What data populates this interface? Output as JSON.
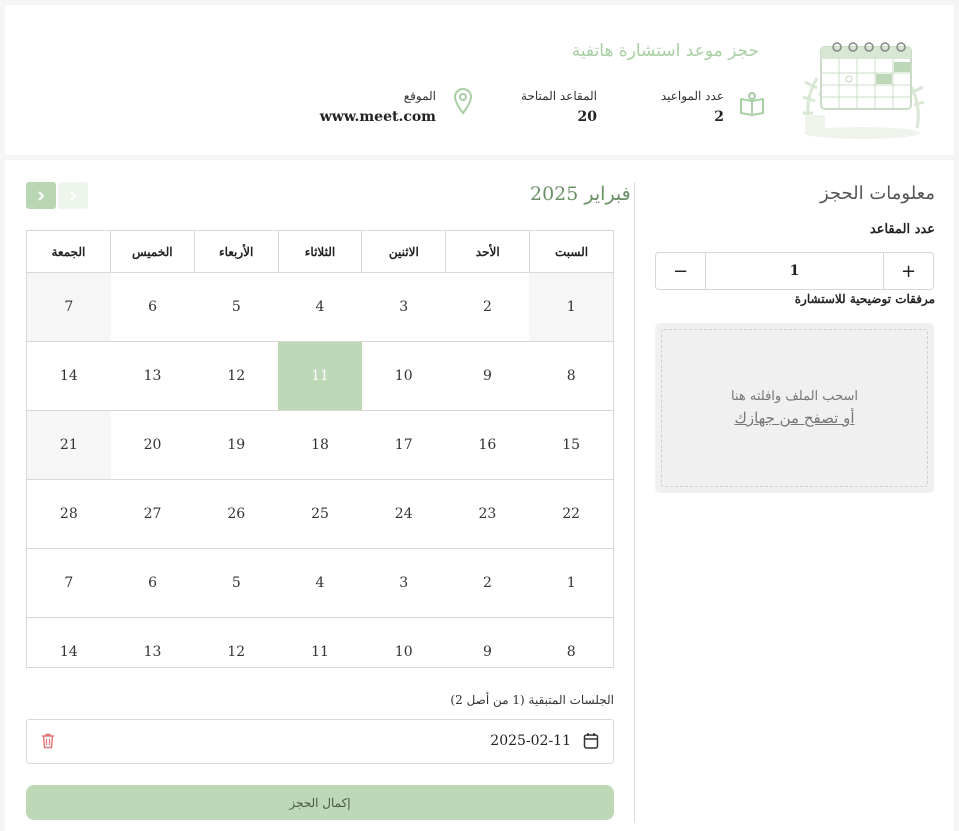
{
  "header": {
    "title": "حجز موعد استشارة هاتفية",
    "stats": [
      {
        "label": "عدد المواعيد",
        "value": "2",
        "icon": "book-icon"
      },
      {
        "label": "المقاعد المتاحة",
        "value": "20"
      },
      {
        "label": "الموقع",
        "value": "www.meet.com",
        "icon": "map-pin-icon"
      }
    ]
  },
  "booking": {
    "title": "معلومات الحجز",
    "seats_label": "عدد المقاعد",
    "seats_value": "1",
    "plus": "+",
    "minus": "−",
    "attachments_label": "مرفقات توضيحية للاستشارة",
    "dropzone_text": "اسحب الملف وافلته هنا",
    "dropzone_link": "أو تصفح من جهازك"
  },
  "calendar": {
    "month_title": "فبراير 2025",
    "weekdays": [
      "السبت",
      "الأحد",
      "الاثنين",
      "الثلاثاء",
      "الأربعاء",
      "الخميس",
      "الجمعة"
    ],
    "rows": [
      [
        "1",
        "2",
        "3",
        "4",
        "5",
        "6",
        "7"
      ],
      [
        "8",
        "9",
        "10",
        "11",
        "12",
        "13",
        "14"
      ],
      [
        "15",
        "16",
        "17",
        "18",
        "19",
        "20",
        "21"
      ],
      [
        "22",
        "23",
        "24",
        "25",
        "26",
        "27",
        "28"
      ],
      [
        "1",
        "2",
        "3",
        "4",
        "5",
        "6",
        "7"
      ],
      [
        "8",
        "9",
        "10",
        "11",
        "12",
        "13",
        "14"
      ]
    ],
    "selected_day": "11"
  },
  "sessions": {
    "label": "الجلسات المتبقية (1 من أصل 2)",
    "items": [
      {
        "date": "2025-02-11"
      }
    ]
  },
  "submit_label": "إكمال الحجز",
  "colors": {
    "accent": "#bcd8b6",
    "accent_text": "#a8cfa3",
    "danger": "#e57373"
  }
}
